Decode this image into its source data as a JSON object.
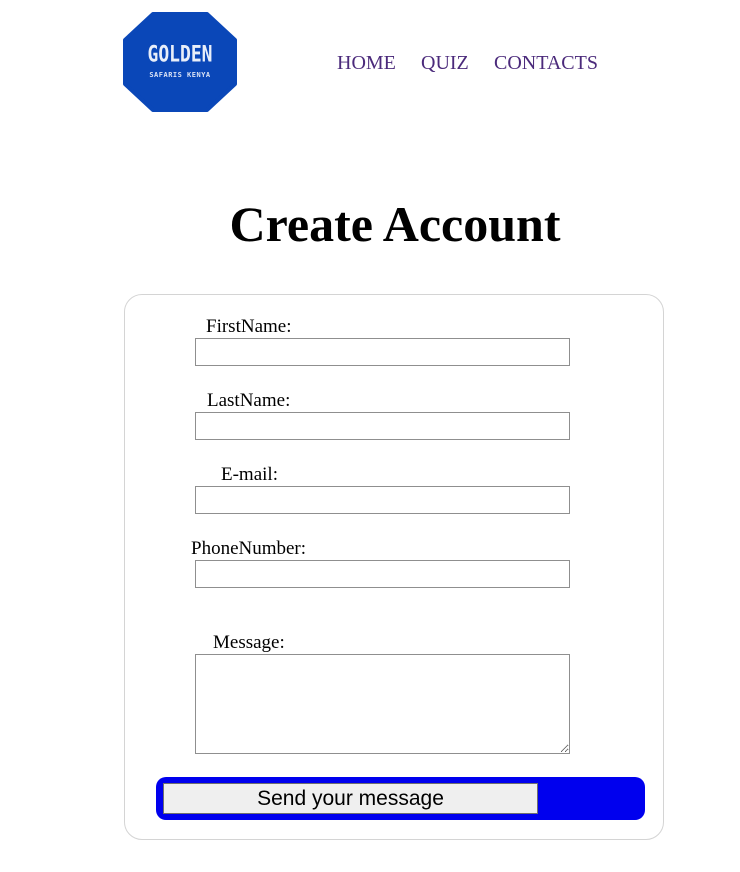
{
  "header": {
    "logo": {
      "title": "GOLDEN",
      "subtitle": "SAFARIS KENYA",
      "color": "#0a47b8"
    },
    "nav": [
      {
        "label": "HOME"
      },
      {
        "label": "QUIZ"
      },
      {
        "label": "CONTACTS"
      }
    ],
    "nav_color": "#4b2a7b"
  },
  "page_title": "Create Account",
  "form": {
    "fields": [
      {
        "label": "FirstName:",
        "value": ""
      },
      {
        "label": "LastName:",
        "value": ""
      },
      {
        "label": "E-mail:",
        "value": ""
      },
      {
        "label": "PhoneNumber:",
        "value": ""
      }
    ],
    "message": {
      "label": "Message:",
      "value": ""
    },
    "submit_label": "Send your message",
    "submit_frame_color": "#0000ee"
  }
}
